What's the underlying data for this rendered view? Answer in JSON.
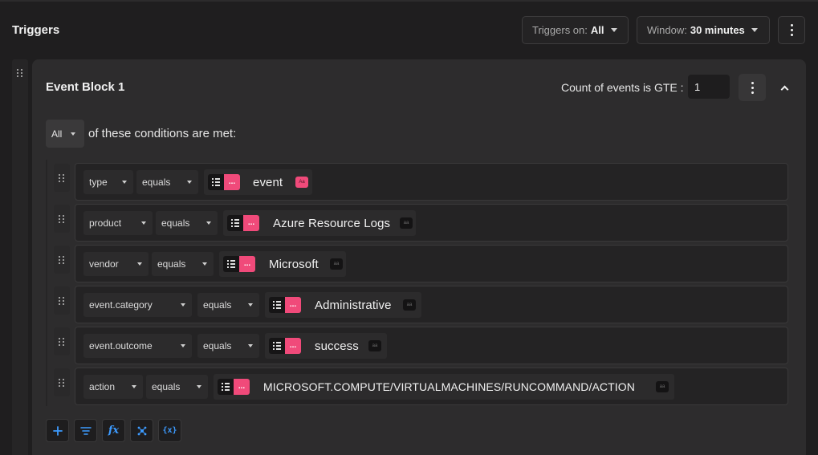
{
  "header": {
    "title": "Triggers",
    "triggers_on_label": "Triggers on:",
    "triggers_on_value": "All",
    "window_label": "Window:",
    "window_value": "30 minutes"
  },
  "event_block": {
    "title": "Event Block 1",
    "count_label": "Count of events is GTE :",
    "count_value": "1",
    "match_mode": "All",
    "match_text": "of these conditions are met:"
  },
  "conditions": [
    {
      "field": "type",
      "operator": "equals",
      "more": "...",
      "value": "event",
      "case_badge": "Aa"
    },
    {
      "field": "product",
      "operator": "equals",
      "more": "...",
      "value": "Azure Resource Logs",
      "case_badge": "aa"
    },
    {
      "field": "vendor",
      "operator": "equals",
      "more": "...",
      "value": "Microsoft",
      "case_badge": "aa"
    },
    {
      "field": "event.category",
      "operator": "equals",
      "more": "...",
      "value": "Administrative",
      "case_badge": "aa"
    },
    {
      "field": "event.outcome",
      "operator": "equals",
      "more": "...",
      "value": "success",
      "case_badge": "aa"
    },
    {
      "field": "action",
      "operator": "equals",
      "more": "...",
      "value": "MICROSOFT.COMPUTE/VIRTUALMACHINES/RUNCOMMAND/ACTION",
      "case_badge": "aa"
    }
  ],
  "toolbar": {
    "icons": [
      "plus-icon",
      "filter-icon",
      "function-icon",
      "network-icon",
      "variable-icon"
    ],
    "function_glyph": "fx",
    "variable_glyph": "{x}"
  },
  "colors": {
    "accent_pink": "#f04a7a",
    "accent_blue": "#3d9bff",
    "background": "#1f1e1f",
    "block_background": "#2d2c2d"
  }
}
